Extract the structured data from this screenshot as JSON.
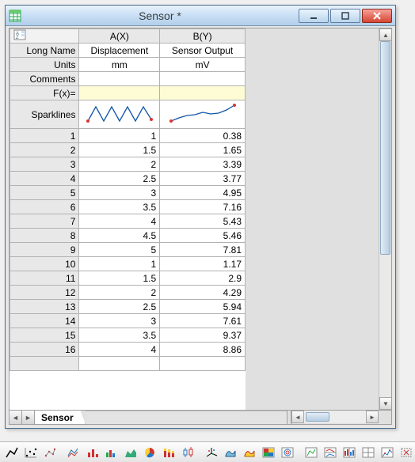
{
  "window": {
    "title": "Sensor *"
  },
  "columns": {
    "A": "A(X)",
    "B": "B(Y)"
  },
  "row_labels": {
    "longname": "Long Name",
    "units": "Units",
    "comments": "Comments",
    "fx": "F(x)=",
    "sparklines": "Sparklines"
  },
  "header_values": {
    "A": {
      "longname": "Displacement",
      "units": "mm",
      "comments": "",
      "fx": ""
    },
    "B": {
      "longname": "Sensor Output",
      "units": "mV",
      "comments": "",
      "fx": ""
    }
  },
  "tab": "Sensor",
  "chart_data": {
    "type": "table",
    "columns": [
      "Displacement (mm)",
      "Sensor Output (mV)"
    ],
    "rows": [
      {
        "n": 1,
        "A": "1",
        "B": "0.38"
      },
      {
        "n": 2,
        "A": "1.5",
        "B": "1.65"
      },
      {
        "n": 3,
        "A": "2",
        "B": "3.39"
      },
      {
        "n": 4,
        "A": "2.5",
        "B": "3.77"
      },
      {
        "n": 5,
        "A": "3",
        "B": "4.95"
      },
      {
        "n": 6,
        "A": "3.5",
        "B": "7.16"
      },
      {
        "n": 7,
        "A": "4",
        "B": "5.43"
      },
      {
        "n": 8,
        "A": "4.5",
        "B": "5.46"
      },
      {
        "n": 9,
        "A": "5",
        "B": "7.81"
      },
      {
        "n": 10,
        "A": "1",
        "B": "1.17"
      },
      {
        "n": 11,
        "A": "1.5",
        "B": "2.9"
      },
      {
        "n": 12,
        "A": "2",
        "B": "4.29"
      },
      {
        "n": 13,
        "A": "2.5",
        "B": "5.94"
      },
      {
        "n": 14,
        "A": "3",
        "B": "7.61"
      },
      {
        "n": 15,
        "A": "3.5",
        "B": "9.37"
      },
      {
        "n": 16,
        "A": "4",
        "B": "8.86"
      }
    ]
  },
  "toolbar_icons": [
    "line-plot",
    "scatter-plot1",
    "scatter-plot2",
    "line-series",
    "column-plot",
    "bar-plot",
    "area-plot",
    "pie-plot",
    "stacked-plot",
    "box-plot",
    "3d-xyz",
    "3d-surface",
    "3d-surface-color",
    "image-plot",
    "matrix-plot",
    "template1",
    "template2",
    "template3",
    "template4",
    "template5",
    "mask-tool",
    "region-tool"
  ]
}
